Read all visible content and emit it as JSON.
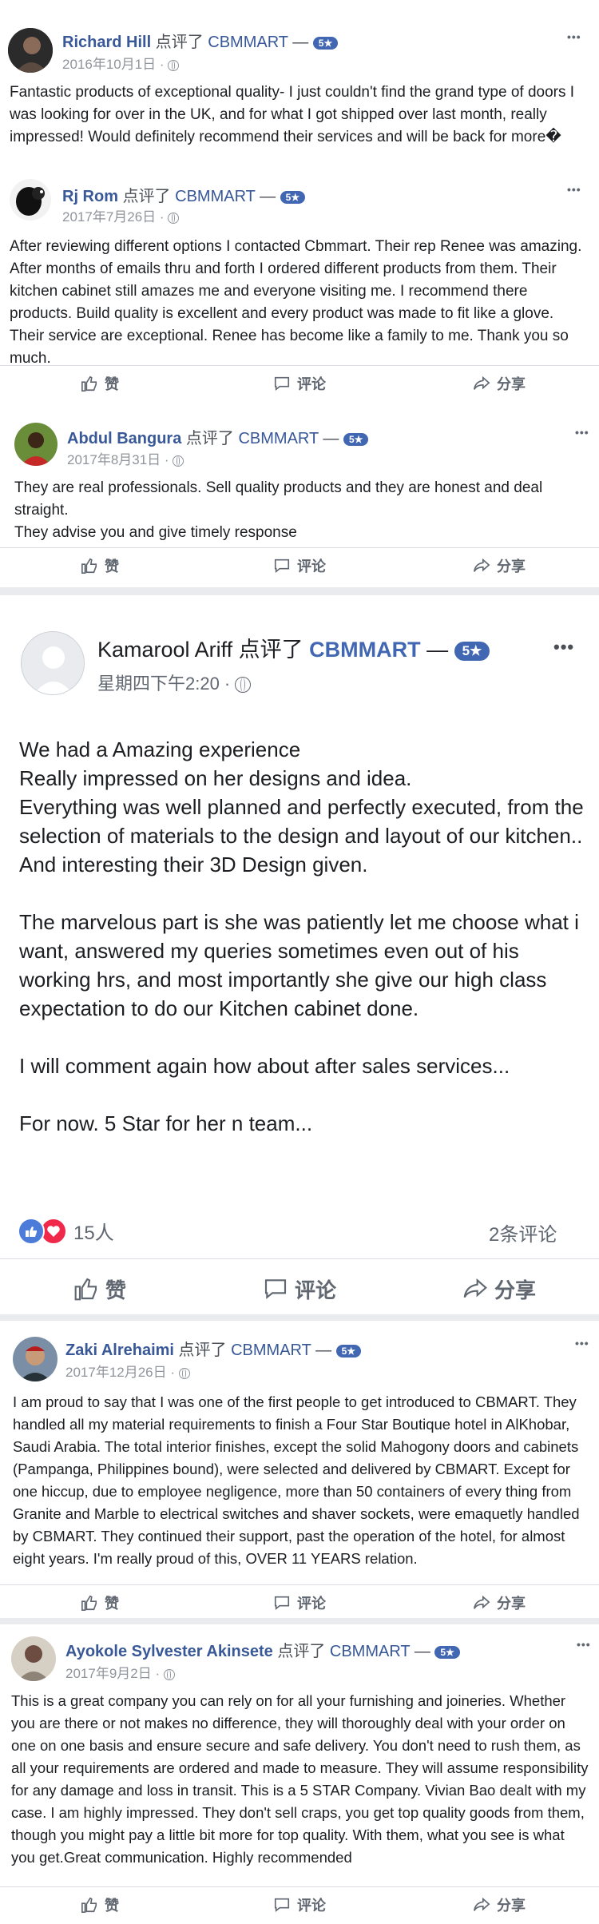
{
  "common": {
    "verb": "点评了",
    "page_name": "CBMMART",
    "dash": "—",
    "rating_badge": "5★",
    "like_label": "赞",
    "comment_label": "评论",
    "share_label": "分享",
    "more": "•••"
  },
  "reviews": [
    {
      "name": "Richard Hill",
      "date": "2016年10月1日 ·",
      "text": "Fantastic products of exceptional quality- I just couldn't find the grand type of doors I was looking for over in the UK, and for what I got shipped over last month, really impressed! Would definitely recommend their services and will be back for more�"
    },
    {
      "name": "Rj Rom",
      "date": "2017年7月26日 ·",
      "text": "After reviewing different options I contacted Cbmmart. Their rep Renee was amazing. After months of emails thru and forth I ordered different products from them. Their kitchen cabinet still amazes me and everyone visiting me. I recommend there products. Build quality is excellent and every product was made to fit like a glove. Their service are exceptional. Renee has become like a family to me. Thank you so much."
    },
    {
      "name": "Abdul Bangura",
      "date": "2017年8月31日 ·",
      "text": "They are real professionals. Sell quality products and they are honest and deal straight.\nThey advise you and give timely response"
    },
    {
      "name": "Kamarool Ariff",
      "date": "星期四下午2:20 ·",
      "text": "We had a Amazing experience\nReally impressed on her designs and idea.\nEverything was well planned and perfectly executed, from the selection of materials to the design and layout of our kitchen.. And interesting their 3D Design given.\n\nThe marvelous part is she was patiently let me choose what i want, answered my queries sometimes even out of his working hrs, and most importantly she give our high class expectation to do our Kitchen cabinet done.\n\nI will comment again how about after sales services...\n\nFor now. 5 Star for her n team...",
      "reactions_count": "15人",
      "comments_count": "2条评论"
    },
    {
      "name": "Zaki Alrehaimi",
      "date": "2017年12月26日 ·",
      "text": "I am proud to say that I was one of the first people to get introduced to CBMART. They handled all my material requirements to finish a Four Star Boutique hotel in AlKhobar, Saudi Arabia. The total interior finishes, except the solid Mahogony doors and cabinets (Pampanga, Philippines bound), were selected and delivered by CBMART. Except for one hiccup, due to employee negligence, more than 50 containers of every thing from Granite and Marble to electrical switches and shaver sockets, were emaquetly handled by CBMART. They continued their support, past the operation of the hotel, for almost eight years. I'm really proud of this, OVER 11 YEARS relation."
    },
    {
      "name": "Ayokole Sylvester Akinsete",
      "date": "2017年9月2日 ·",
      "text": "This is a great company you can rely on for all your furnishing and joineries. Whether you are there or not makes no difference, they will thoroughly deal with your order on one on one basis and ensure secure and safe delivery. You don't need to rush them, as all your requirements are ordered and made to measure. They will assume responsibility for any damage and loss in transit. This is a 5 STAR Company. Vivian Bao dealt with my case. I am highly impressed. They don't sell craps, you get top quality goods from them, though you might pay a little bit more for top quality. With them, what you see is what you get.Great communication. Highly recommended"
    }
  ],
  "colors": {
    "name": "#385898",
    "badge": "#4267b2",
    "meta": "#90949c",
    "separator": "#e9ebee"
  }
}
